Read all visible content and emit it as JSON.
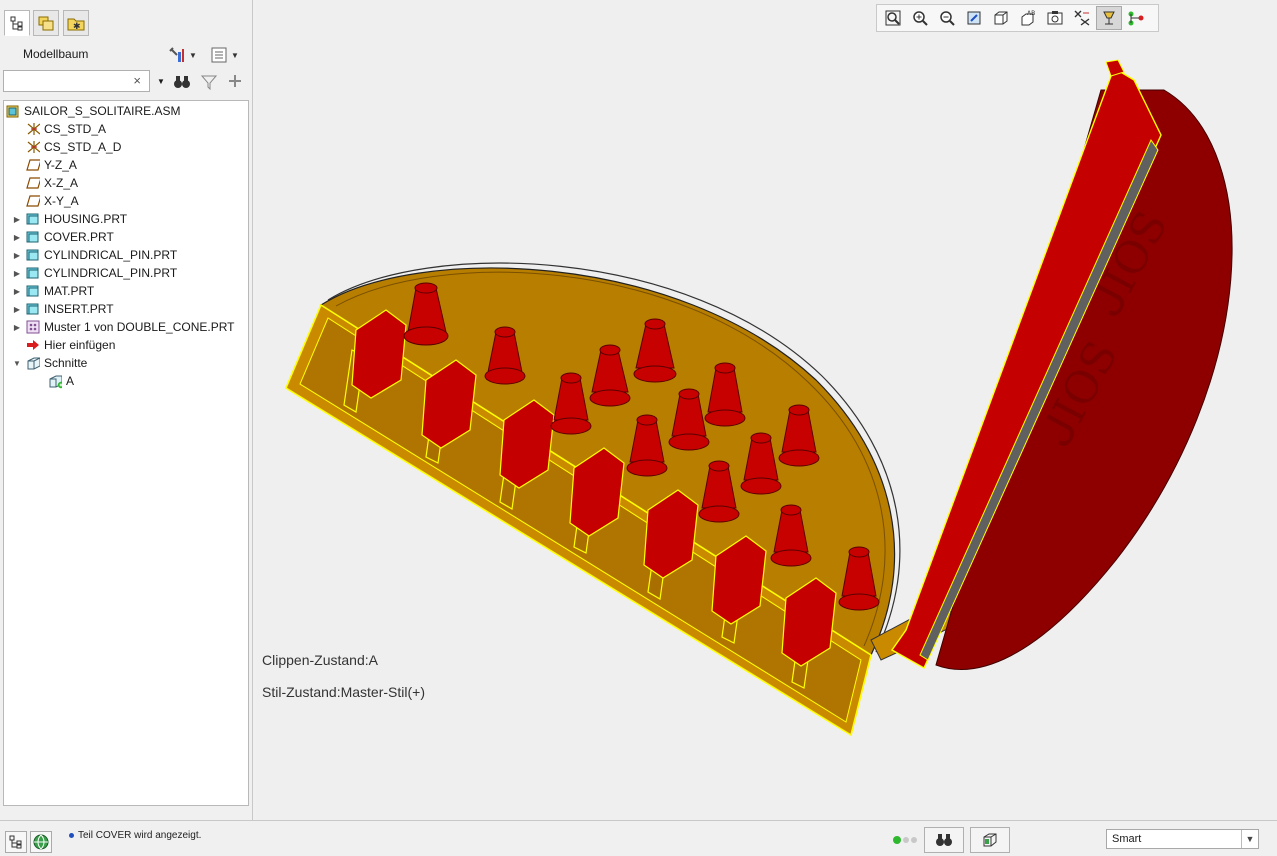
{
  "panel": {
    "title": "Modellbaum",
    "search": {
      "value": "",
      "placeholder": ""
    },
    "clear_symbol": "×",
    "tabs": [
      {
        "icon": "model-tree-icon"
      },
      {
        "icon": "folder-browser-icon"
      },
      {
        "icon": "favorites-icon"
      }
    ]
  },
  "tree": {
    "items": [
      {
        "label": "SAILOR_S_SOLITAIRE.ASM",
        "icon": "assembly-icon",
        "level": 0,
        "expander": ""
      },
      {
        "label": "CS_STD_A",
        "icon": "coordinate-system-icon",
        "level": 1,
        "expander": ""
      },
      {
        "label": "CS_STD_A_D",
        "icon": "coordinate-system-icon",
        "level": 1,
        "expander": ""
      },
      {
        "label": "Y-Z_A",
        "icon": "datum-plane-icon",
        "level": 1,
        "expander": ""
      },
      {
        "label": "X-Z_A",
        "icon": "datum-plane-icon",
        "level": 1,
        "expander": ""
      },
      {
        "label": "X-Y_A",
        "icon": "datum-plane-icon",
        "level": 1,
        "expander": ""
      },
      {
        "label": "HOUSING.PRT",
        "icon": "part-icon",
        "level": 1,
        "expander": "collapsed"
      },
      {
        "label": "COVER.PRT",
        "icon": "part-icon",
        "level": 1,
        "expander": "collapsed"
      },
      {
        "label": "CYLINDRICAL_PIN.PRT",
        "icon": "part-icon",
        "level": 1,
        "expander": "collapsed"
      },
      {
        "label": "CYLINDRICAL_PIN.PRT",
        "icon": "part-icon",
        "level": 1,
        "expander": "collapsed"
      },
      {
        "label": "MAT.PRT",
        "icon": "part-icon",
        "level": 1,
        "expander": "collapsed"
      },
      {
        "label": "INSERT.PRT",
        "icon": "part-icon",
        "level": 1,
        "expander": "collapsed"
      },
      {
        "label": "Muster 1 von DOUBLE_CONE.PRT",
        "icon": "pattern-icon",
        "level": 1,
        "expander": "collapsed"
      },
      {
        "label": "Hier einfügen",
        "icon": "insert-here-arrow-icon",
        "level": 1,
        "expander": ""
      },
      {
        "label": "Schnitte",
        "icon": "sections-icon",
        "level": 1,
        "expander": "expanded"
      },
      {
        "label": "A",
        "icon": "section-icon",
        "level": 2,
        "expander": ""
      }
    ]
  },
  "viewport": {
    "clip_state": "Clippen-Zustand:A",
    "style_state": "Stil-Zustand:Master-Stil(+)",
    "toolbar": [
      "refit-icon",
      "zoom-in-icon",
      "zoom-out-icon",
      "repaint-icon",
      "display-style-icon",
      "saved-orientations-icon",
      "view-manager-icon",
      "datum-display-icon",
      "annotation-display-icon",
      "spin-center-icon"
    ]
  },
  "status": {
    "message": "Teil COVER wird angezeigt.",
    "filter": "Smart",
    "colors": {
      "part_red": "#b30000",
      "part_gold": "#d39a00",
      "highlight": "#ffff00",
      "message_dot": "#2050c0",
      "ok_green": "#2eb82e"
    }
  }
}
